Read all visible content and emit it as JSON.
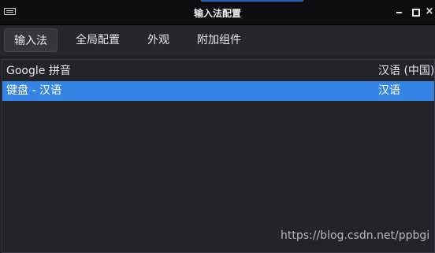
{
  "window": {
    "title": "输入法配置"
  },
  "tabs": [
    {
      "label": "输入法",
      "active": true
    },
    {
      "label": "全局配置",
      "active": false
    },
    {
      "label": "外观",
      "active": false
    },
    {
      "label": "附加组件",
      "active": false
    }
  ],
  "input_methods": [
    {
      "name": "Google 拼音",
      "language": "汉语 (中国)",
      "selected": false
    },
    {
      "name": "键盘 - 汉语",
      "language": "汉语",
      "selected": true
    }
  ],
  "watermark": "https://blog.csdn.net/ppbgi",
  "colors": {
    "selection": "#3584e4",
    "titlebar": "#0d0d0f",
    "background": "#222226"
  },
  "icons": {
    "window_icon": "keyboard-icon",
    "minimize": "minimize-icon",
    "maximize": "maximize-icon",
    "close": "close-icon"
  }
}
